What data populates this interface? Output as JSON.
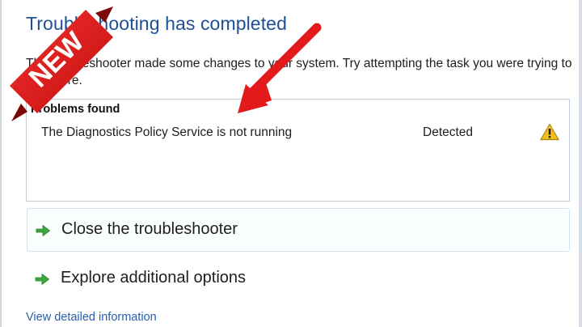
{
  "dialog": {
    "heading": "Troubleshooting has completed",
    "description": "The troubleshooter made some changes to your system. Try attempting the task you were trying to do before."
  },
  "problems": {
    "title": "Problems found",
    "items": [
      {
        "text": "The Diagnostics Policy Service is not running",
        "status": "Detected",
        "icon": "warning-icon"
      }
    ]
  },
  "actions": [
    {
      "label": "Close the troubleshooter",
      "icon": "green-arrow-icon"
    },
    {
      "label": "Explore additional options",
      "icon": "green-arrow-icon"
    }
  ],
  "links": {
    "details": "View detailed information"
  },
  "overlay": {
    "badge_text": "NEW",
    "badge_color": "#e3191b",
    "arrow_color": "#e3191b"
  },
  "colors": {
    "heading": "#1f4f95",
    "link": "#2a5eb0",
    "action_arrow": "#3ca93f",
    "warning": "#f2c21a"
  }
}
